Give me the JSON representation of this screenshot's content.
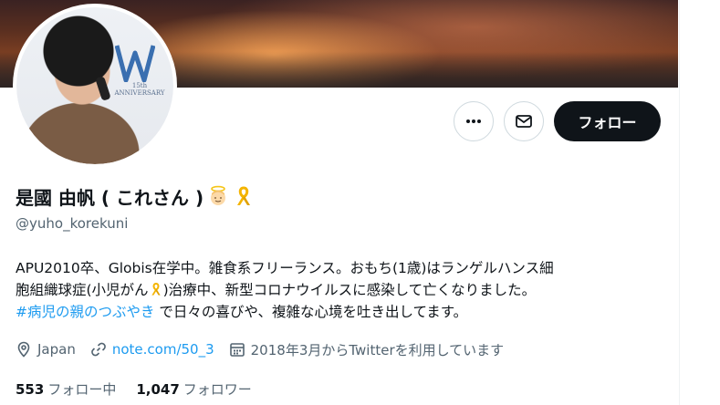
{
  "profile": {
    "display_name": "是國 由帆 ( これさん )",
    "handle": "@yuho_korekuni",
    "avatar_logo_text": "15th\nANNIVERSARY",
    "emojis": [
      "angel-emoji",
      "gold-ribbon-emoji"
    ]
  },
  "actions": {
    "more_icon": "more-horizontal-icon",
    "message_icon": "envelope-icon",
    "follow_label": "フォロー"
  },
  "bio": {
    "line1": "APU2010卒、Globis在学中。雑食系フリーランス。おもち(1歳)はランゲルハンス細",
    "line2_before": "胞組織球症(小児がん",
    "line2_after": ")治療中、新型コロナウイルスに感染して亡くなりました。",
    "hashtag": "#病児の親のつぶやき",
    "line3_after": " で日々の喜びや、複雑な心境を吐き出してます。"
  },
  "meta": {
    "location": "Japan",
    "website": "note.com/50_3",
    "joined": "2018年3月からTwitterを利用しています"
  },
  "counts": {
    "following_num": "553",
    "following_label": "フォロー中",
    "followers_num": "1,047",
    "followers_label": "フォロワー"
  },
  "colors": {
    "accent": "#1d9bf0",
    "text": "#0f1419",
    "muted": "#536471",
    "follow_bg": "#0f1419",
    "ribbon": "#f4b400"
  }
}
